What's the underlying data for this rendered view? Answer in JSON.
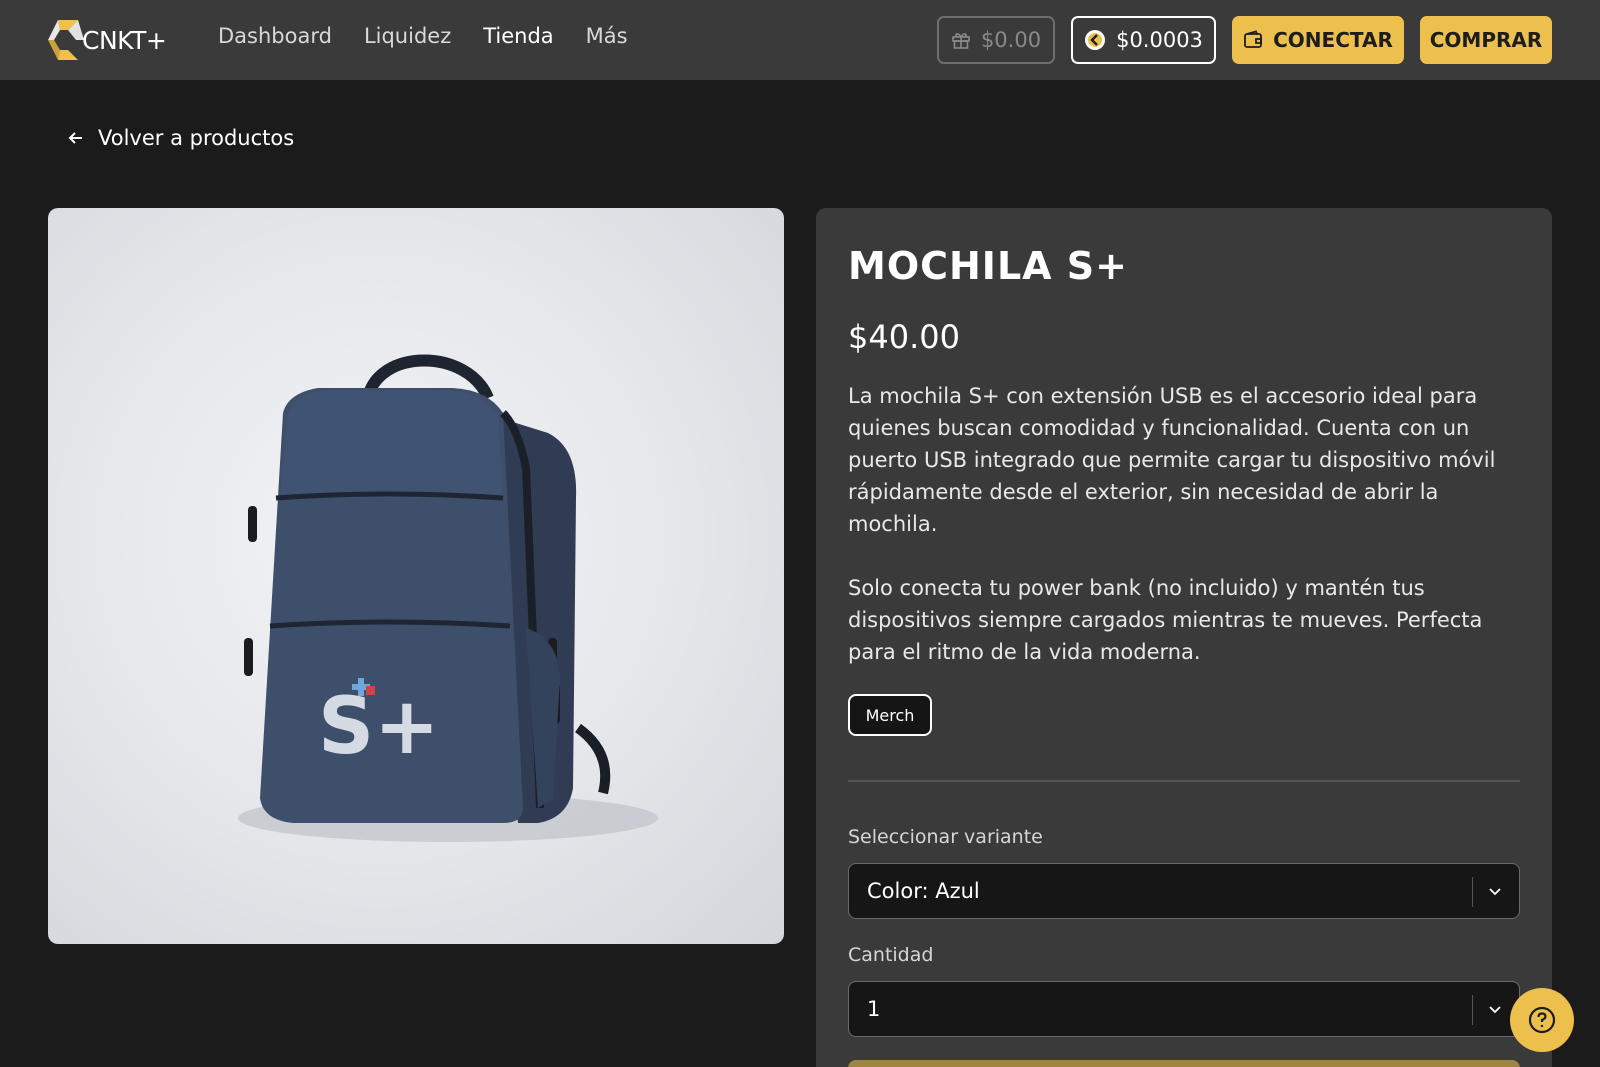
{
  "brand": {
    "logo_text": "CNKT+"
  },
  "nav": {
    "items": [
      "Dashboard",
      "Liquidez",
      "Tienda",
      "Más"
    ]
  },
  "header": {
    "gift_balance": "$0.00",
    "token_balance": "$0.0003",
    "connect_label": "CONECTAR",
    "buy_label": "COMPRAR"
  },
  "back_label": "Volver a productos",
  "product": {
    "title": "MOCHILA S+",
    "price": "$40.00",
    "description_1": "La mochila S+ con extensión USB es el accesorio ideal para quienes buscan comodidad y funcionalidad. Cuenta con un puerto USB integrado que permite cargar tu dispositivo móvil rápidamente desde el exterior, sin necesidad de abrir la mochila.",
    "description_2": "Solo conecta tu power bank (no incluido) y mantén tus dispositivos siempre cargados mientras te mueves. Perfecta para el ritmo de la vida moderna.",
    "tag": "Merch",
    "image_logo_text": "S+"
  },
  "form": {
    "variant_label": "Seleccionar variante",
    "variant_value": "Color: Azul",
    "quantity_label": "Cantidad",
    "quantity_value": "1"
  },
  "colors": {
    "accent": "#edc04d",
    "header_bg": "#3a3a3b",
    "page_bg": "#1b1b1c",
    "backpack": "#3e4f6b"
  },
  "icons": [
    "gift-icon",
    "coin-icon",
    "wallet-icon",
    "arrow-left-icon",
    "chevron-down-icon",
    "help-icon"
  ]
}
